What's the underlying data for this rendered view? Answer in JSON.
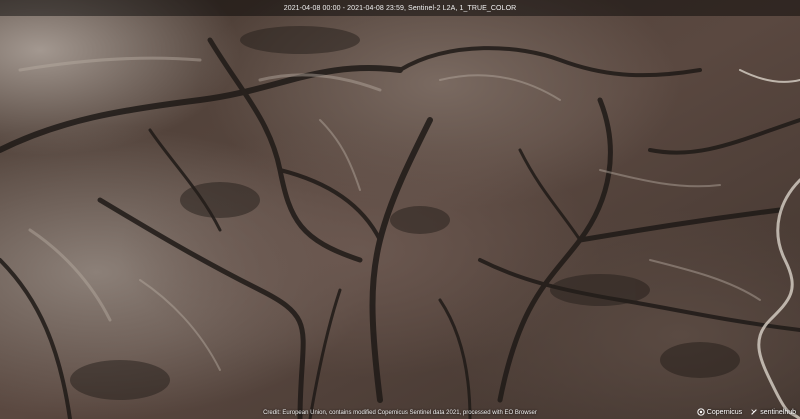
{
  "map": {
    "header": "2021-04-08 00:00 - 2021-04-08 23:59, Sentinel-2 L2A, 1_TRUE_COLOR",
    "credit": "Credit: European Union, contains modified Copernicus Sentinel data 2021, processed with EO Browser",
    "logos": {
      "copernicus": "Copernicus",
      "sentinelhub": "sentinelhub"
    },
    "colors": {
      "terrain_base": "#4a3b33",
      "ridge_light": "#b8aca2",
      "valley_dark": "#1f1a17",
      "riverbed": "#d9d2c8"
    }
  }
}
